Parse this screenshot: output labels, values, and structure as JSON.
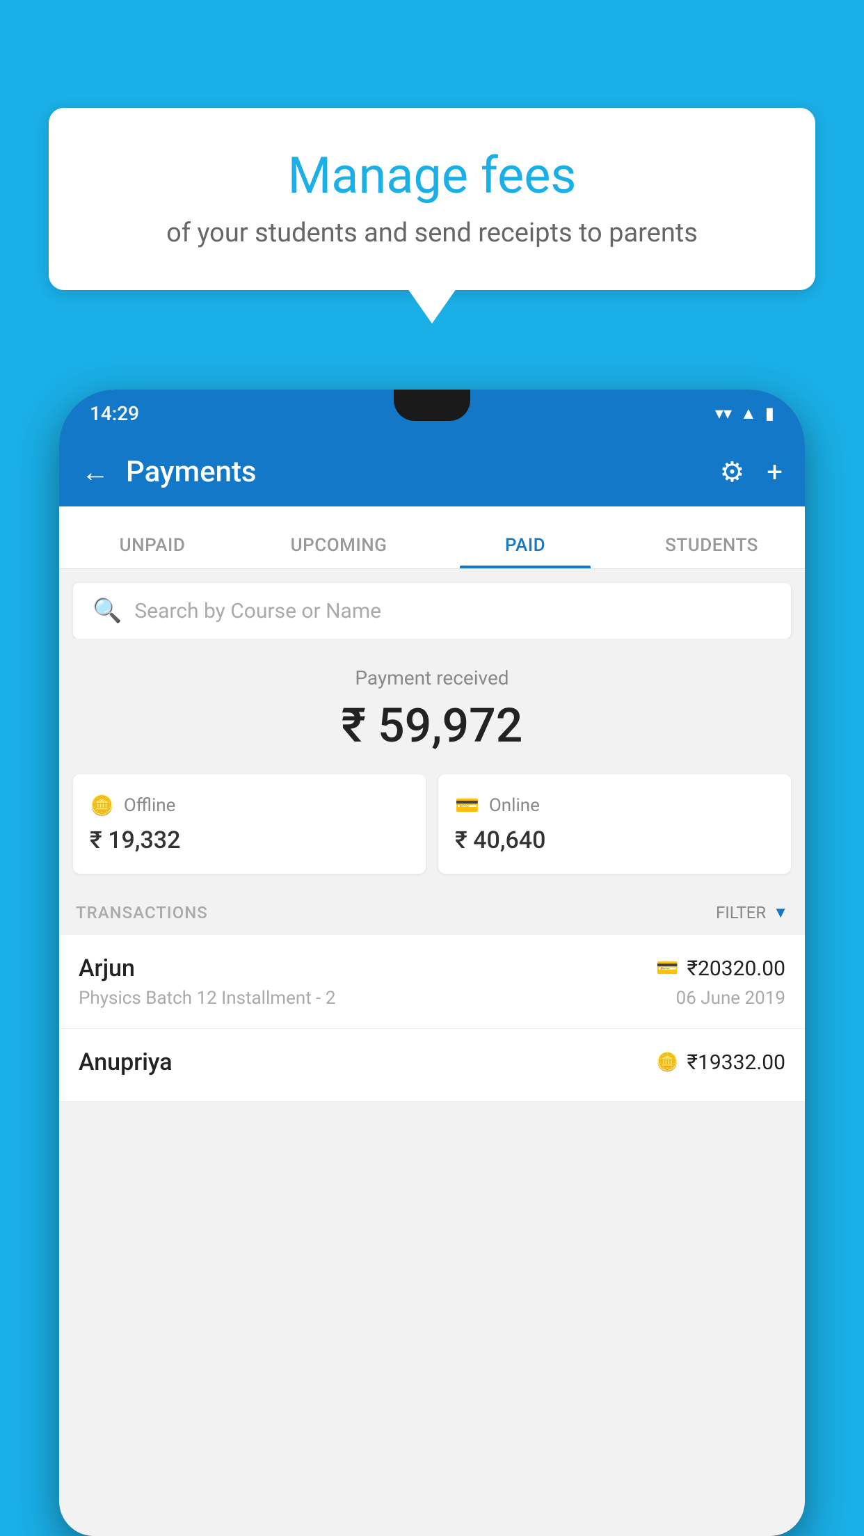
{
  "background_color": "#1AAFE6",
  "bubble": {
    "title": "Manage fees",
    "subtitle": "of your students and send receipts to parents"
  },
  "phone": {
    "status_bar": {
      "time": "14:29",
      "wifi_icon": "wifi",
      "signal_icon": "signal",
      "battery_icon": "battery"
    },
    "app_bar": {
      "title": "Payments",
      "back_label": "←",
      "gear_label": "⚙",
      "plus_label": "+"
    },
    "tabs": [
      {
        "label": "UNPAID",
        "active": false
      },
      {
        "label": "UPCOMING",
        "active": false
      },
      {
        "label": "PAID",
        "active": true
      },
      {
        "label": "STUDENTS",
        "active": false
      }
    ],
    "search": {
      "placeholder": "Search by Course or Name"
    },
    "payment_received": {
      "label": "Payment received",
      "amount": "₹ 59,972"
    },
    "payment_cards": [
      {
        "type": "Offline",
        "icon": "💵",
        "amount": "₹ 19,332"
      },
      {
        "type": "Online",
        "icon": "💳",
        "amount": "₹ 40,640"
      }
    ],
    "transactions_section": {
      "label": "TRANSACTIONS",
      "filter_label": "FILTER"
    },
    "transactions": [
      {
        "name": "Arjun",
        "detail": "Physics Batch 12 Installment - 2",
        "amount": "₹20320.00",
        "date": "06 June 2019",
        "payment_type": "online"
      },
      {
        "name": "Anupriya",
        "detail": "",
        "amount": "₹19332.00",
        "date": "",
        "payment_type": "offline"
      }
    ]
  }
}
